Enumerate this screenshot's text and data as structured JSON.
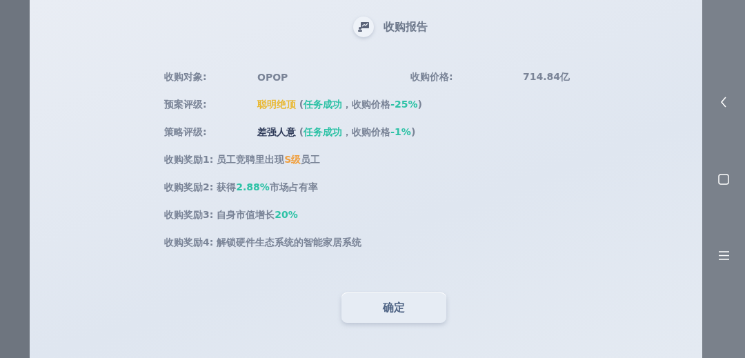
{
  "title": "收购报告",
  "target": {
    "label": "收购对象:",
    "value": "OPOP"
  },
  "price": {
    "label": "收购价格:",
    "value": "714.84亿"
  },
  "ratings": [
    {
      "label": "预案评级:",
      "parts": [
        {
          "text": "聪明绝顶",
          "color": "#e9b832"
        },
        {
          "text": " (",
          "color": "#7a8497"
        },
        {
          "text": "任务成功",
          "color": "#2ec2a6"
        },
        {
          "text": "，收购价格",
          "color": "#7a8497"
        },
        {
          "text": "-25%",
          "color": "#2ec2a6"
        },
        {
          "text": ")",
          "color": "#7a8497"
        }
      ]
    },
    {
      "label": "策略评级:",
      "parts": [
        {
          "text": "差强人意",
          "color": "#2e3a58"
        },
        {
          "text": " (",
          "color": "#7a8497"
        },
        {
          "text": "任务成功",
          "color": "#2ec2a6"
        },
        {
          "text": "，收购价格",
          "color": "#7a8497"
        },
        {
          "text": "-1%",
          "color": "#2ec2a6"
        },
        {
          "text": ")",
          "color": "#7a8497"
        }
      ]
    }
  ],
  "rewards": [
    {
      "parts": [
        {
          "text": "收购奖励1: 员工竞聘里出现",
          "color": "#7a8497"
        },
        {
          "text": "S级",
          "color": "#f0a040"
        },
        {
          "text": "员工",
          "color": "#7a8497"
        }
      ]
    },
    {
      "parts": [
        {
          "text": "收购奖励2: 获得",
          "color": "#7a8497"
        },
        {
          "text": "2.88%",
          "color": "#2ec2a6"
        },
        {
          "text": "市场占有率",
          "color": "#7a8497"
        }
      ]
    },
    {
      "parts": [
        {
          "text": "收购奖励3: 自身市值增长",
          "color": "#7a8497"
        },
        {
          "text": "20%",
          "color": "#2ec2a6"
        }
      ]
    },
    {
      "parts": [
        {
          "text": "收购奖励4: 解锁硬件生态系统的智能家居系统",
          "color": "#7a8497"
        }
      ]
    }
  ],
  "confirm": "确定"
}
